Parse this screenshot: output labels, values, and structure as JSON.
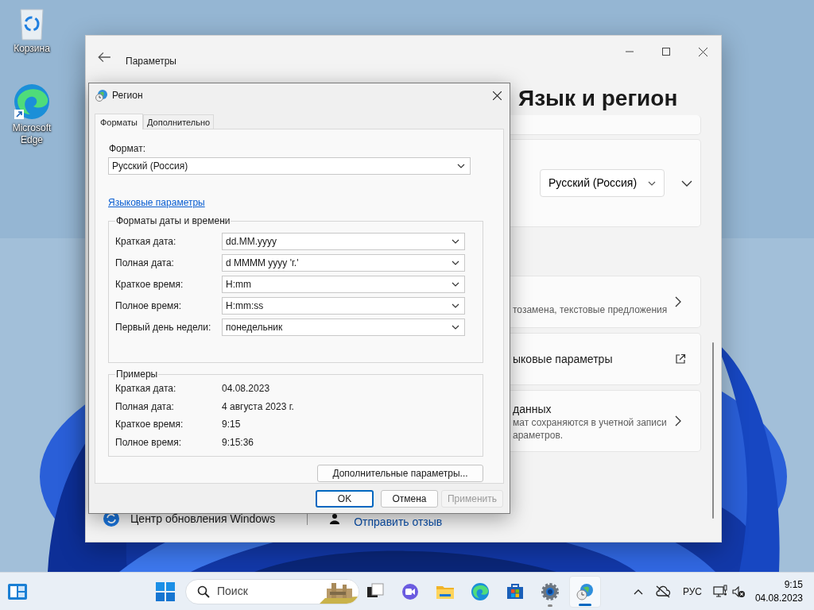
{
  "desktop_icons": [
    {
      "kind": "recycle",
      "label": "Корзина"
    },
    {
      "kind": "edge",
      "label": "Microsoft Edge"
    }
  ],
  "settings": {
    "title": "Параметры",
    "heading": "Язык и регион",
    "cards": [
      {
        "kind": "dropdown",
        "value": "Русский (Россия)"
      },
      {
        "kind": "chevron",
        "lines": [
          "тозамена, текстовые предложения"
        ]
      },
      {
        "kind": "external",
        "title": "ыковые параметры"
      },
      {
        "kind": "chevron",
        "title": "данных",
        "lines": [
          "мат сохраняются в учетной записи",
          "араметров."
        ]
      }
    ],
    "footer": [
      {
        "kind": "update",
        "label": "Центр обновления Windows"
      },
      {
        "kind": "feedback",
        "label": "Отправить отзыв"
      }
    ]
  },
  "dialog": {
    "title": "Регион",
    "tabs": [
      {
        "label": "Форматы",
        "selected": true
      },
      {
        "label": "Дополнительно",
        "selected": false
      }
    ],
    "format_label": "Формат:",
    "format_value": "Русский (Россия)",
    "language_link": "Языковые параметры",
    "formats_group": {
      "title": "Форматы даты и времени",
      "rows": [
        {
          "label": "Краткая дата:",
          "value": "dd.MM.yyyy"
        },
        {
          "label": "Полная дата:",
          "value": "d MMMM yyyy 'г.'"
        },
        {
          "label": "Краткое время:",
          "value": "H:mm"
        },
        {
          "label": "Полное время:",
          "value": "H:mm:ss"
        },
        {
          "label": "Первый день недели:",
          "value": "понедельник"
        }
      ]
    },
    "examples_group": {
      "title": "Примеры",
      "rows": [
        {
          "label": "Краткая дата:",
          "value": "04.08.2023"
        },
        {
          "label": "Полная дата:",
          "value": "4 августа 2023 г."
        },
        {
          "label": "Краткое время:",
          "value": "9:15"
        },
        {
          "label": "Полное время:",
          "value": "9:15:36"
        }
      ]
    },
    "more_button": "Дополнительные параметры...",
    "buttons": [
      {
        "label": "OK",
        "default": true,
        "disabled": false
      },
      {
        "label": "Отмена",
        "default": false,
        "disabled": false
      },
      {
        "label": "Применить",
        "default": false,
        "disabled": true
      }
    ]
  },
  "taskbar": {
    "search_placeholder": "Поиск",
    "apps": [
      {
        "kind": "task-view",
        "running": false,
        "active": false
      },
      {
        "kind": "chat",
        "running": false,
        "active": false
      },
      {
        "kind": "explorer",
        "running": false,
        "active": false
      },
      {
        "kind": "edge",
        "running": false,
        "active": false
      },
      {
        "kind": "store",
        "running": false,
        "active": false
      },
      {
        "kind": "settings",
        "running": true,
        "active": false
      },
      {
        "kind": "region",
        "running": true,
        "active": true
      }
    ],
    "language": "РУС",
    "time": "9:15",
    "date": "04.08.2023"
  }
}
